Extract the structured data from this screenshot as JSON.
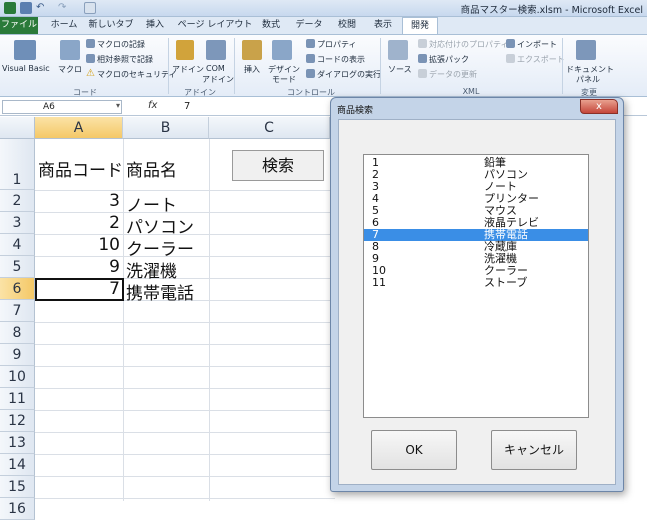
{
  "window": {
    "title": "商品マスター検索.xlsm - Microsoft Excel"
  },
  "tabs": [
    "ファイル",
    "ホーム",
    "新しいタブ",
    "挿入",
    "ページ レイアウト",
    "数式",
    "データ",
    "校閲",
    "表示",
    "開発"
  ],
  "ribbon": {
    "code": {
      "visual_basic": "Visual Basic",
      "macro": "マクロ",
      "record": "マクロの記録",
      "relative": "相対参照で記録",
      "security": "マクロのセキュリティ",
      "label": "コード"
    },
    "addins": {
      "addin": "アドイン",
      "com": "COM",
      "com2": "アドイン",
      "label": "アドイン"
    },
    "controls": {
      "insert": "挿入",
      "design": "デザイン",
      "design2": "モード",
      "properties": "プロパティ",
      "view_code": "コードの表示",
      "run_dialog": "ダイアログの実行",
      "label": "コントロール"
    },
    "xml": {
      "source": "ソース",
      "map_props": "対応付けのプロパティ",
      "expansion": "拡張パック",
      "refresh": "データの更新",
      "import": "インポート",
      "export": "エクスポート",
      "label": "XML"
    },
    "modify": {
      "doc_panel": "ドキュメント",
      "doc_panel2": "パネル",
      "label": "変更"
    }
  },
  "formula_bar": {
    "name_box": "A6",
    "fx": "fx",
    "value": "7"
  },
  "columns": [
    "A",
    "B",
    "C"
  ],
  "rows": [
    "1",
    "2",
    "3",
    "4",
    "5",
    "6",
    "7",
    "8",
    "9",
    "10",
    "11",
    "12",
    "13",
    "14",
    "15",
    "16"
  ],
  "sheet": {
    "header_a": "商品コード",
    "header_b": "商品名",
    "data": [
      {
        "code": "3",
        "name": "ノート"
      },
      {
        "code": "2",
        "name": "パソコン"
      },
      {
        "code": "10",
        "name": "クーラー"
      },
      {
        "code": "9",
        "name": "洗濯機"
      },
      {
        "code": "7",
        "name": "携帯電話"
      }
    ],
    "search_button": "検索"
  },
  "dialog": {
    "title": "商品検索",
    "close": "x",
    "items": [
      {
        "code": "1",
        "name": "鉛筆"
      },
      {
        "code": "2",
        "name": "パソコン"
      },
      {
        "code": "3",
        "name": "ノート"
      },
      {
        "code": "4",
        "name": "プリンター"
      },
      {
        "code": "5",
        "name": "マウス"
      },
      {
        "code": "6",
        "name": "液晶テレビ"
      },
      {
        "code": "7",
        "name": "携帯電話"
      },
      {
        "code": "8",
        "name": "冷蔵庫"
      },
      {
        "code": "9",
        "name": "洗濯機"
      },
      {
        "code": "10",
        "name": "クーラー"
      },
      {
        "code": "11",
        "name": "ストーブ"
      }
    ],
    "selected_code": "7",
    "ok": "OK",
    "cancel": "キャンセル"
  }
}
